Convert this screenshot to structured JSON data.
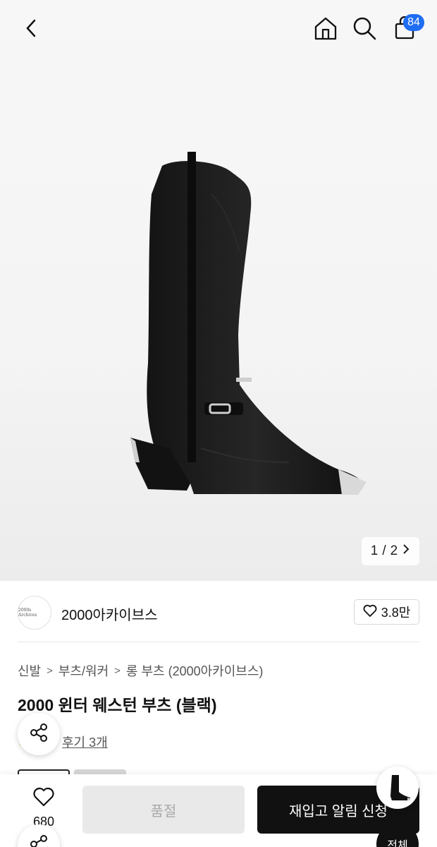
{
  "header": {
    "back_icon": "chevron-left-icon",
    "home_icon": "home-icon",
    "search_icon": "search-icon",
    "cart_icon": "shopping-bag-icon",
    "cart_count": "84",
    "cart_badge_color": "#1f6df2"
  },
  "gallery": {
    "current": "1",
    "separator": "/",
    "total": "2",
    "next_icon": "chevron-right-icon"
  },
  "brand": {
    "logo_text": "2000s Archives",
    "name": "2000아카이브스",
    "like_icon": "heart-outline-icon",
    "like_count": "3.8만"
  },
  "breadcrumb": {
    "items": [
      "신발",
      "부츠/워커",
      "롱 부츠 (2000아카이브스)"
    ],
    "separator": ">"
  },
  "product": {
    "title": "2000 윈터 웨스턴 부츠 (블랙)",
    "stars": "★",
    "review_link": "후기 3개"
  },
  "bottom_bar": {
    "wish_icon": "heart-outline-icon",
    "wish_count": "680",
    "soldout_label": "품절",
    "restock_label": "재입고 알림 신청",
    "primary_color": "#111111"
  },
  "floating": {
    "share_icon": "share-icon",
    "all_label": "전체"
  }
}
